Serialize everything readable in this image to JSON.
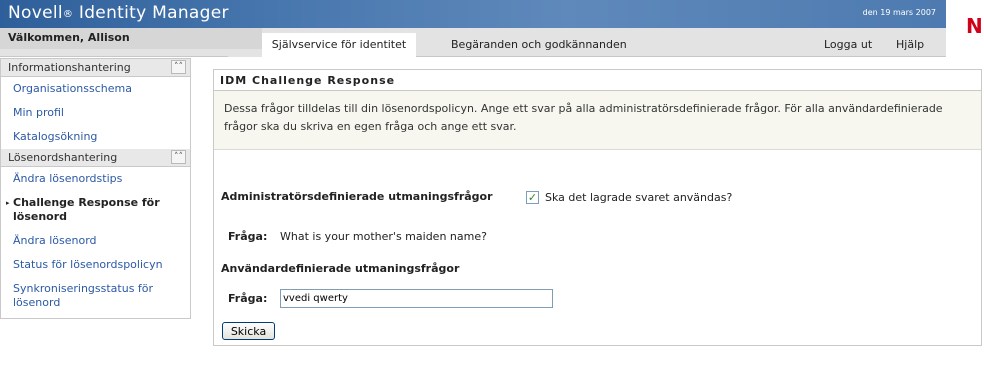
{
  "header": {
    "brand": "Novell",
    "brand_mark": "®",
    "product": " Identity Manager",
    "date": "den 19 mars 2007",
    "logo_text": "N",
    "welcome": "Välkommen, Allison",
    "tabs": [
      {
        "label": "Självservice för identitet",
        "active": true
      },
      {
        "label": "Begäranden och godkännanden",
        "active": false
      }
    ],
    "logout": "Logga ut",
    "help": "Hjälp"
  },
  "sidebar": {
    "sections": [
      {
        "title": "Informationshantering",
        "items": [
          {
            "label": "Organisationsschema"
          },
          {
            "label": "Min profil"
          },
          {
            "label": "Katalogsökning"
          }
        ]
      },
      {
        "title": "Lösenordshantering",
        "items": [
          {
            "label": "Ändra lösenordstips"
          },
          {
            "label": "Challenge Response för lösenord",
            "active": true
          },
          {
            "label": "Ändra lösenord"
          },
          {
            "label": "Status för lösenordspolicyn"
          },
          {
            "label": "Synkroniseringsstatus för lösenord"
          }
        ]
      }
    ]
  },
  "main": {
    "title": "IDM Challenge Response",
    "description": "Dessa frågor tilldelas till din lösenordspolicyn. Ange ett svar på alla administratörsdefinierade frågor. För alla användardefinierade frågor ska du skriva en egen fråga och ange ett svar.",
    "admin_heading": "Administratörsdefinierade utmaningsfrågor",
    "use_saved_label": "Ska det lagrade svaret användas?",
    "use_saved_checked": true,
    "question_label": "Fråga:",
    "admin_question": "What is your mother's maiden name?",
    "user_heading": "Användardefinierade utmaningsfrågor",
    "user_question_value": "vvedi qwerty",
    "submit": "Skicka"
  },
  "colors": {
    "banner": "#4877ae",
    "link": "#2c59a6",
    "logo": "#d0021b"
  }
}
